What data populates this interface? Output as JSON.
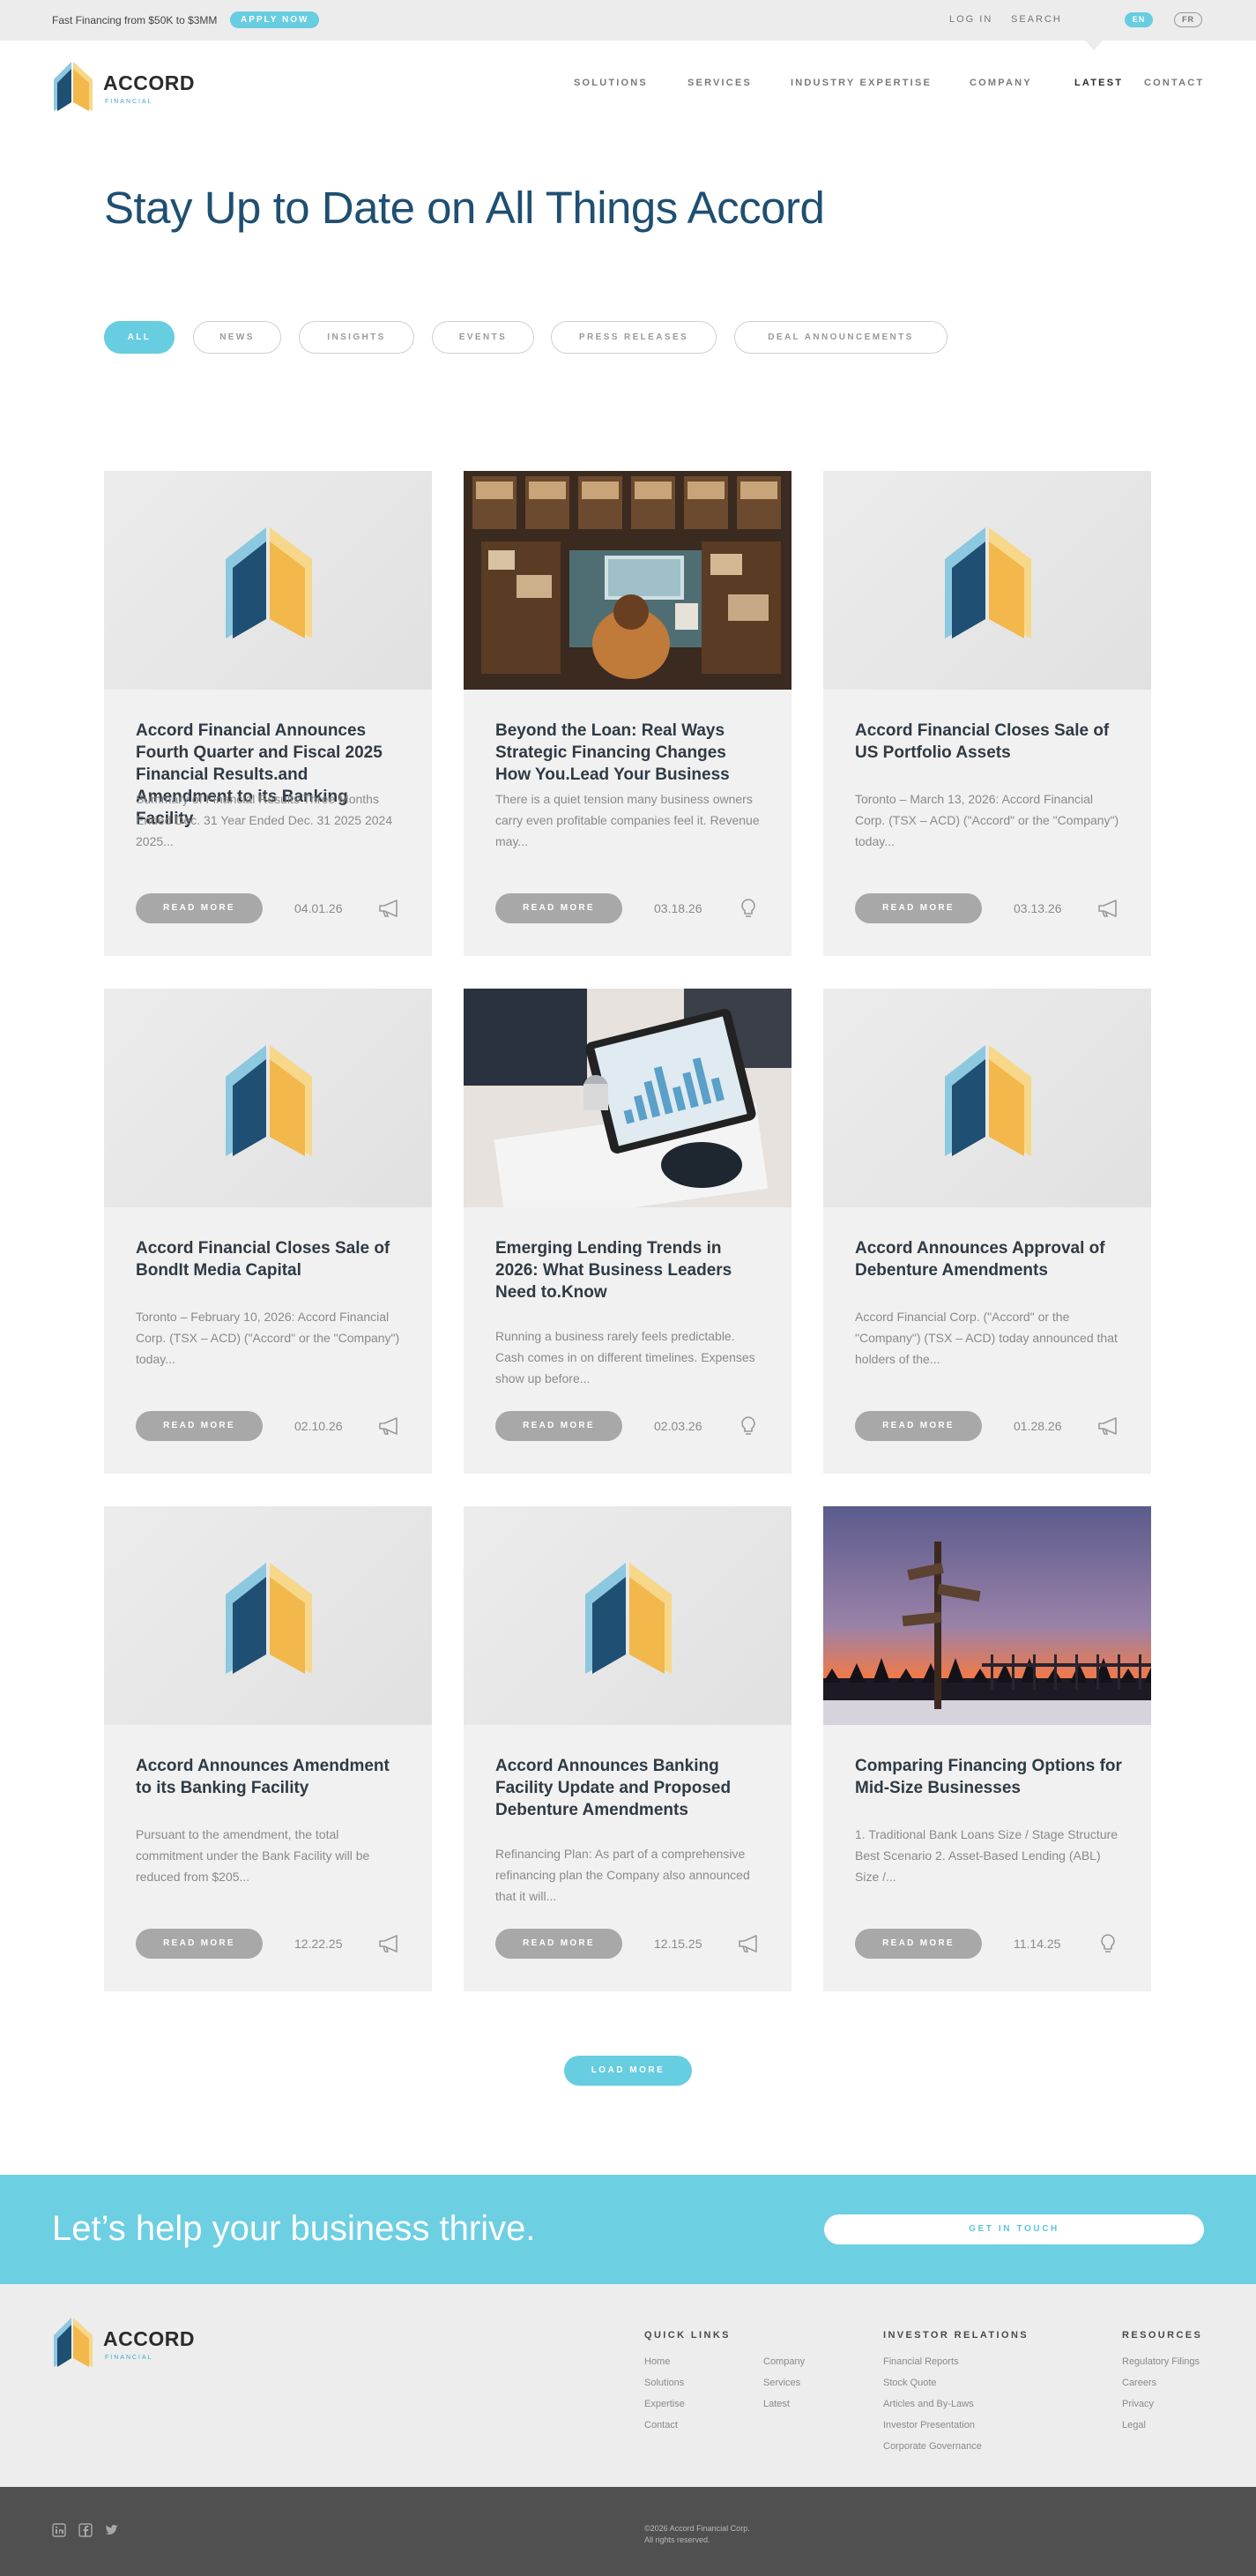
{
  "topbar": {
    "promo": "Fast Financing from $50K to $3MM",
    "apply_label": "APPLY NOW",
    "login": "LOG IN",
    "search": "SEARCH",
    "lang_en": "EN",
    "lang_fr": "FR"
  },
  "brand": {
    "name": "ACCORD",
    "sub": "FINANCIAL",
    "colors": {
      "dark_blue": "#1f4f72",
      "light_blue": "#8cc8e0",
      "yellow": "#f2b84b",
      "light_yellow": "#f7d88a",
      "accent": "#67cde0"
    }
  },
  "nav": {
    "items": [
      {
        "label": "SOLUTIONS"
      },
      {
        "label": "SERVICES"
      },
      {
        "label": "INDUSTRY EXPERTISE"
      },
      {
        "label": "COMPANY"
      },
      {
        "label": "LATEST",
        "active": true
      },
      {
        "label": "CONTACT"
      }
    ]
  },
  "page": {
    "title": "Stay Up to Date on All Things Accord"
  },
  "filters": [
    {
      "label": "ALL",
      "active": true
    },
    {
      "label": "NEWS"
    },
    {
      "label": "INSIGHTS"
    },
    {
      "label": "EVENTS"
    },
    {
      "label": "PRESS RELEASES"
    },
    {
      "label": "DEAL ANNOUNCEMENTS"
    }
  ],
  "cards": [
    {
      "title": "Accord Financial Announces Fourth Quarter and Fiscal 2025 Financial Results.and Amendment to its Banking Facility",
      "excerpt": "Summary of Financial Results Three Months Ended Dec. 31 Year Ended Dec. 31 2025 2024 2025...",
      "read_more": "READ MORE",
      "date": "04.01.26",
      "icon": "megaphone-icon",
      "media": "logo"
    },
    {
      "title": "Beyond the Loan: Real Ways Strategic Financing Changes How You.Lead Your Business",
      "excerpt": "There is a quiet tension many business owners carry even profitable companies feel it. Revenue may...",
      "read_more": "READ MORE",
      "date": "03.18.26",
      "icon": "lightbulb-icon",
      "media": "office-photo"
    },
    {
      "title": "Accord Financial Closes Sale of US Portfolio Assets",
      "excerpt": "Toronto – March 13, 2026: Accord Financial Corp. (TSX – ACD) (\"Accord\" or the \"Company\") today...",
      "read_more": "READ MORE",
      "date": "03.13.26",
      "icon": "megaphone-icon",
      "media": "logo"
    },
    {
      "title": "Accord Financial Closes Sale of BondIt Media Capital",
      "excerpt": "Toronto – February 10, 2026: Accord Financial Corp. (TSX – ACD) (\"Accord\" or the \"Company\") today...",
      "read_more": "READ MORE",
      "date": "02.10.26",
      "icon": "megaphone-icon",
      "media": "logo"
    },
    {
      "title": "Emerging Lending Trends in 2026: What Business Leaders Need to.Know",
      "excerpt": "Running a business rarely feels predictable. Cash comes in on different timelines. Expenses show up before...",
      "read_more": "READ MORE",
      "date": "02.03.26",
      "icon": "lightbulb-icon",
      "media": "tablet-photo"
    },
    {
      "title": "Accord Announces Approval of Debenture Amendments",
      "excerpt": "Accord Financial Corp. (\"Accord\" or the \"Company\") (TSX – ACD) today announced that holders of the...",
      "read_more": "READ MORE",
      "date": "01.28.26",
      "icon": "megaphone-icon",
      "media": "logo"
    },
    {
      "title": "Accord Announces Amendment to its Banking Facility",
      "excerpt": "Pursuant to the amendment, the total commitment under the Bank Facility will be reduced from $205...",
      "read_more": "READ MORE",
      "date": "12.22.25",
      "icon": "megaphone-icon",
      "media": "logo"
    },
    {
      "title": "Accord Announces Banking Facility Update and Proposed Debenture Amendments",
      "excerpt": "Refinancing Plan: As part of a comprehensive refinancing plan the Company also announced that it will...",
      "read_more": "READ MORE",
      "date": "12.15.25",
      "icon": "megaphone-icon",
      "media": "logo"
    },
    {
      "title": "Comparing Financing Options for Mid-Size Businesses",
      "excerpt": "1. Traditional Bank Loans Size / Stage Structure Best Scenario 2. Asset-Based Lending (ABL) Size /...",
      "read_more": "READ MORE",
      "date": "11.14.25",
      "icon": "lightbulb-icon",
      "media": "signpost-photo"
    }
  ],
  "load_more": "LOAD MORE",
  "cta": {
    "text": "Let’s help your business thrive.",
    "button": "GET IN TOUCH"
  },
  "footer": {
    "quick_links": {
      "heading": "QUICK LINKS",
      "col1": [
        "Home",
        "Solutions",
        "Expertise",
        "Contact"
      ],
      "col2": [
        "Company",
        "Services",
        "Latest"
      ]
    },
    "investor": {
      "heading": "INVESTOR RELATIONS",
      "items": [
        "Financial Reports",
        "Stock Quote",
        "Articles and By-Laws",
        "Investor Presentation",
        "Corporate Governance"
      ]
    },
    "resources": {
      "heading": "RESOURCES",
      "items": [
        "Regulatory Filings",
        "Careers",
        "Privacy",
        "Legal"
      ]
    },
    "copyright": "©2026 Accord Financial Corp.",
    "rights": "All rights reserved.",
    "social": [
      "linkedin-icon",
      "facebook-icon",
      "twitter-icon"
    ]
  }
}
